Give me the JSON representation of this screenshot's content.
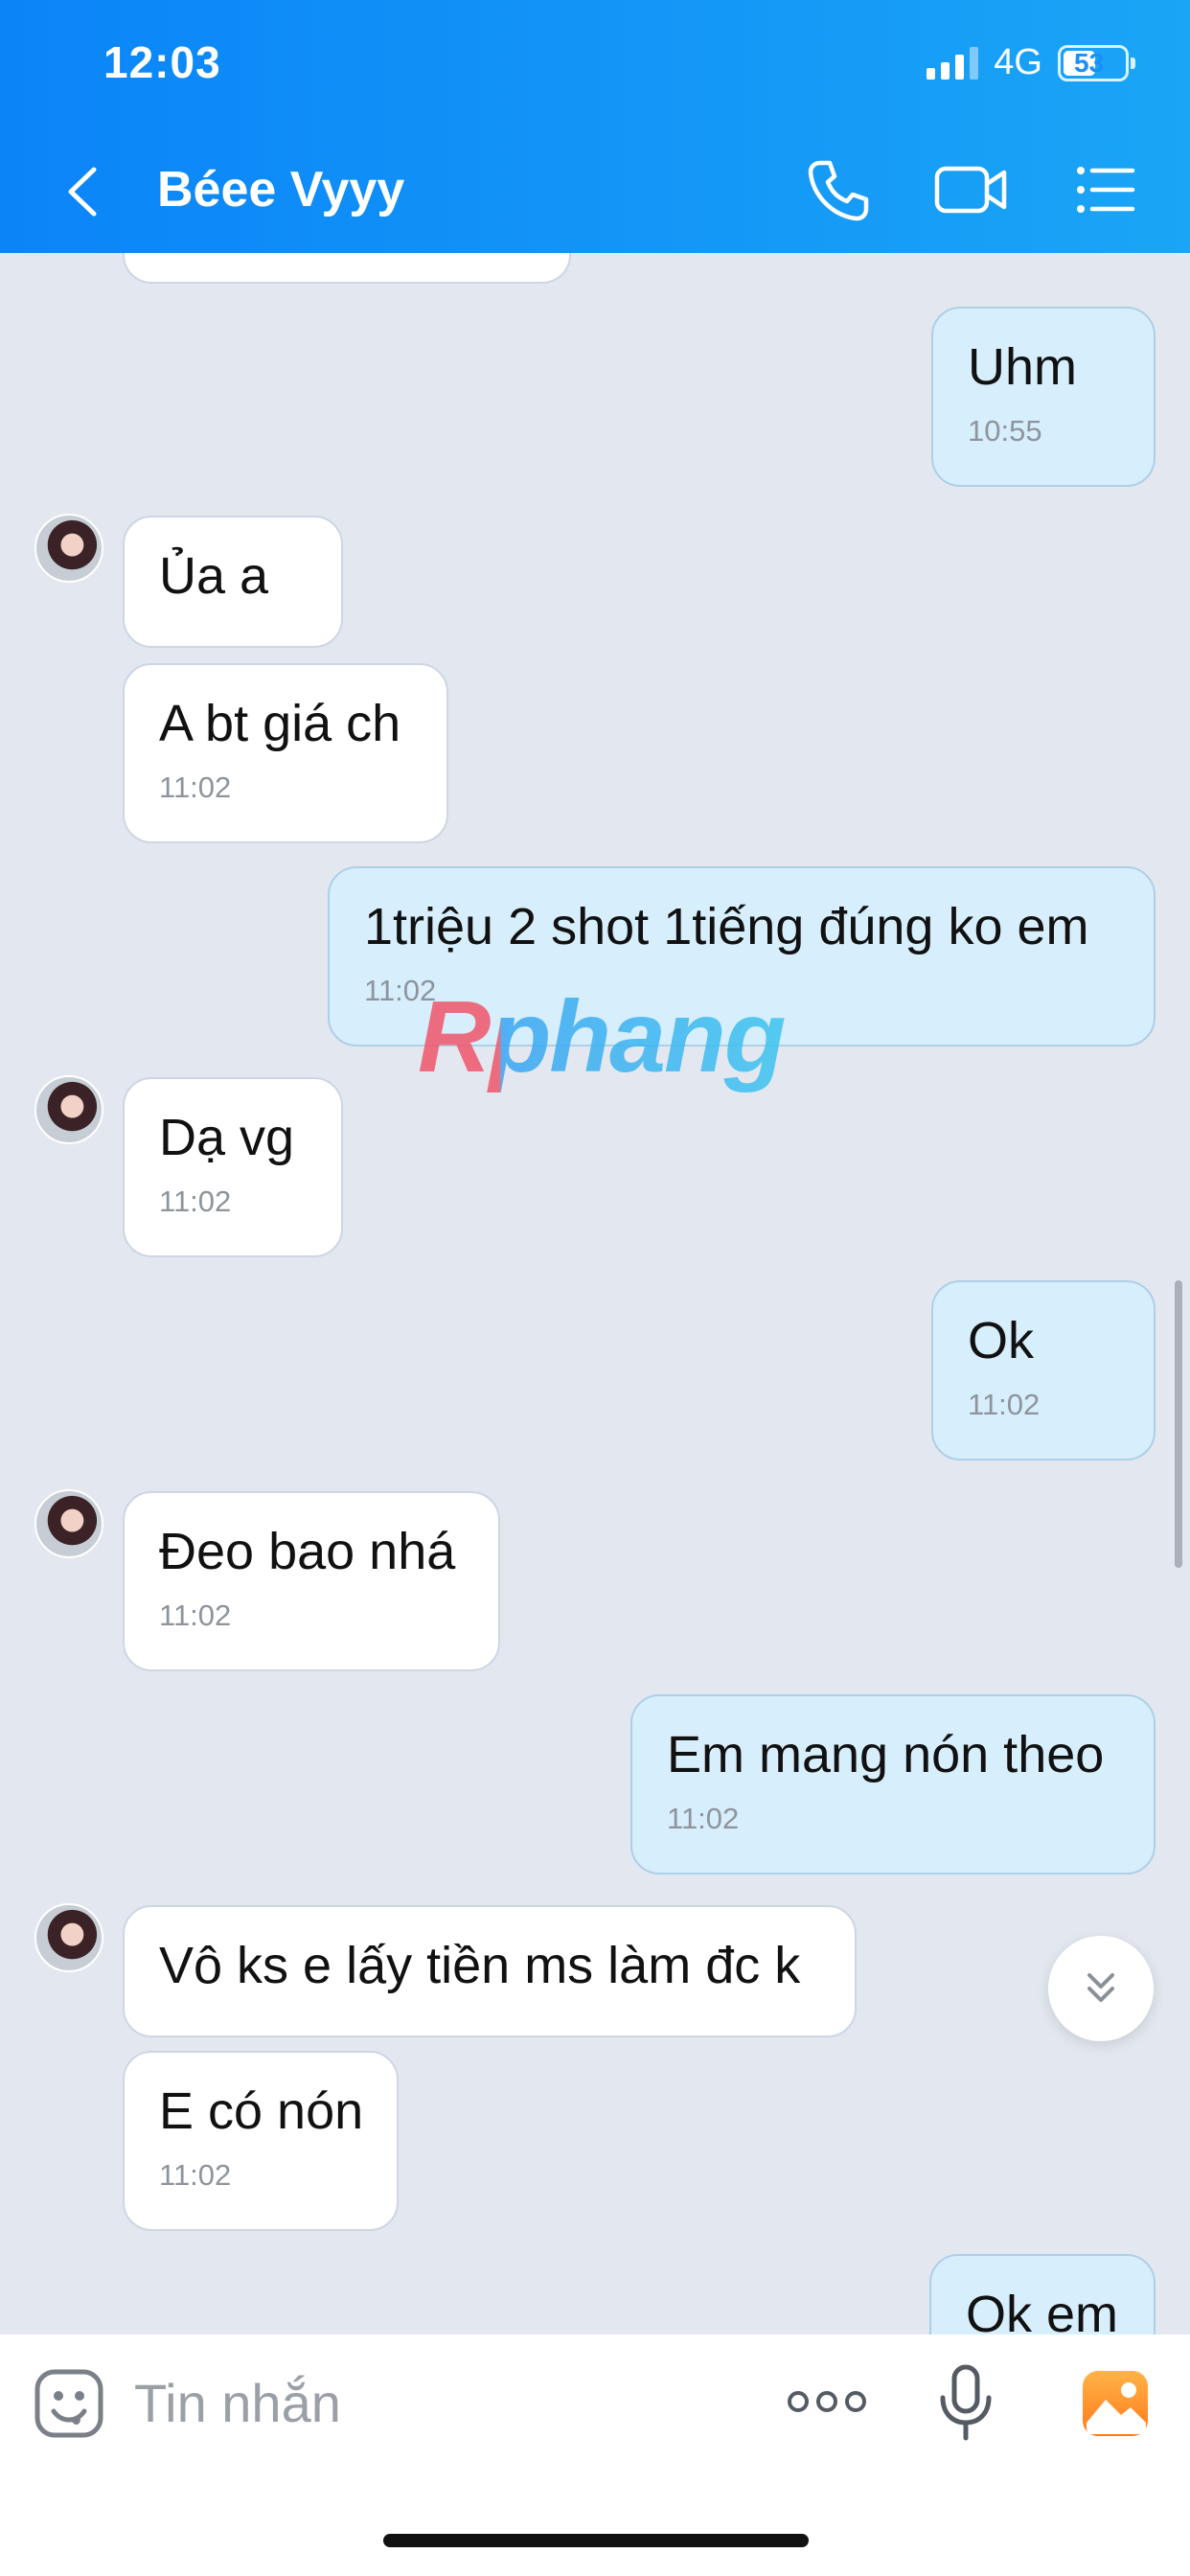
{
  "status_bar": {
    "time": "12:03",
    "network": "4G",
    "battery": "53",
    "battery_level": 0.53
  },
  "header": {
    "title": "Béee Vyyy"
  },
  "messages": [
    {
      "text": "Uhm",
      "time": "10:55"
    },
    {
      "text": "Ủa a"
    },
    {
      "text": "A bt giá ch",
      "time": "11:02"
    },
    {
      "text": "1triệu 2 shot 1tiếng đúng ko em",
      "time": "11:02"
    },
    {
      "text": "Dạ vg",
      "time": "11:02"
    },
    {
      "text": "Ok",
      "time": "11:02"
    },
    {
      "text": "Đeo bao nhá",
      "time": "11:02"
    },
    {
      "text": "Em mang nón theo",
      "time": "11:02"
    },
    {
      "text": "Vô ks e lấy tiền ms làm đc k"
    },
    {
      "text": "E có nón",
      "time": "11:02"
    },
    {
      "text": "Ok em"
    }
  ],
  "watermark": "Rphang",
  "input": {
    "placeholder": "Tin nhắn"
  },
  "colors": {
    "header_start": "#0b84f8",
    "header_end": "#1aa5f6",
    "outgoing_bubble": "#d7eefc",
    "incoming_bubble": "#ffffff",
    "chat_background": "#e3e8f0"
  }
}
